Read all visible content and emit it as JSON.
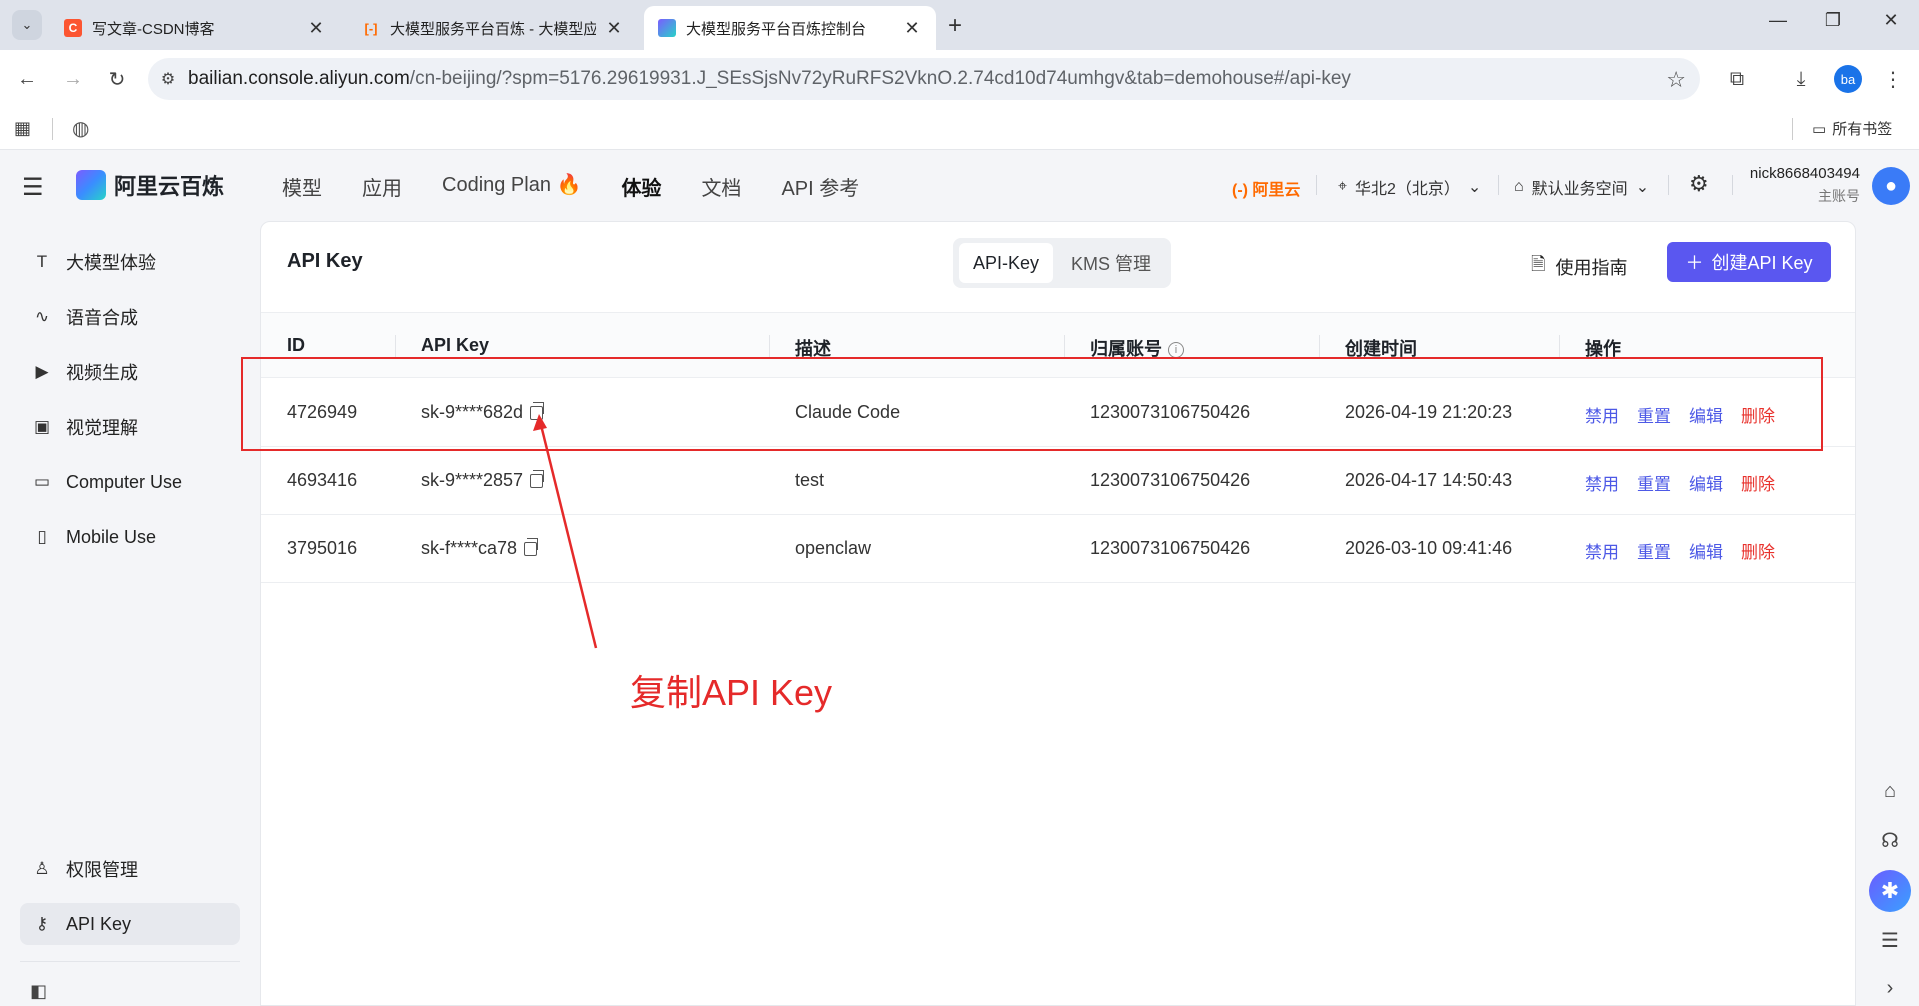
{
  "browser": {
    "tabs": [
      {
        "title": "写文章-CSDN博客",
        "favicon": "C",
        "favicon_color": "#fc5531"
      },
      {
        "title": "大模型服务平台百炼 - 大模型应",
        "favicon": "[-]",
        "favicon_color": "#ff6a00"
      },
      {
        "title": "大模型服务平台百炼控制台",
        "favicon": "",
        "favicon_color": "#6a5cff"
      }
    ],
    "url_host": "bailian.console.aliyun.com",
    "url_path": "/cn-beijing/?spm=5176.29619931.J_SEsSjsNv72yRuRFS2VknO.2.74cd10d74umhgv&tab=demohouse#/api-key",
    "profile": "ba",
    "all_bookmarks": "所有书签"
  },
  "header": {
    "logo_text": "阿里云百炼",
    "nav": [
      {
        "label": "模型"
      },
      {
        "label": "应用"
      },
      {
        "label": "Coding Plan"
      },
      {
        "label": "体验"
      },
      {
        "label": "文档"
      },
      {
        "label": "API 参考"
      }
    ],
    "aliyun": "(-) 阿里云",
    "region": "华北2（北京）",
    "workspace": "默认业务空间",
    "username": "nick8668403494",
    "role": "主账号"
  },
  "sidebar": {
    "items": [
      {
        "label": "大模型体验",
        "icon": "text-icon"
      },
      {
        "label": "语音合成",
        "icon": "audio-wave-icon"
      },
      {
        "label": "视频生成",
        "icon": "video-icon"
      },
      {
        "label": "视觉理解",
        "icon": "image-icon"
      },
      {
        "label": "Computer Use",
        "icon": "monitor-icon"
      },
      {
        "label": "Mobile Use",
        "icon": "phone-icon"
      }
    ],
    "bottom_items": [
      {
        "label": "权限管理",
        "icon": "user-icon"
      },
      {
        "label": "API Key",
        "icon": "key-icon"
      }
    ]
  },
  "main": {
    "title": "API Key",
    "segments": [
      "API-Key",
      "KMS 管理"
    ],
    "guide_label": "使用指南",
    "create_label": "创建API Key",
    "columns": [
      "ID",
      "API Key",
      "描述",
      "归属账号",
      "创建时间",
      "操作"
    ],
    "rows": [
      {
        "id": "4726949",
        "key": "sk-9****682d",
        "desc": "Claude Code",
        "account": "1230073106750426",
        "created": "2026-04-19 21:20:23"
      },
      {
        "id": "4693416",
        "key": "sk-9****2857",
        "desc": "test",
        "account": "1230073106750426",
        "created": "2026-04-17 14:50:43"
      },
      {
        "id": "3795016",
        "key": "sk-f****ca78",
        "desc": "openclaw",
        "account": "1230073106750426",
        "created": "2026-03-10 09:41:46"
      }
    ],
    "actions": [
      "禁用",
      "重置",
      "编辑",
      "删除"
    ]
  },
  "annotation": {
    "text": "复制API Key",
    "color": "#e52a2a"
  },
  "colors": {
    "primary": "#5a57f0",
    "link": "#4d59e6",
    "danger": "#e8322d",
    "aliyun_orange": "#ff6a00"
  }
}
